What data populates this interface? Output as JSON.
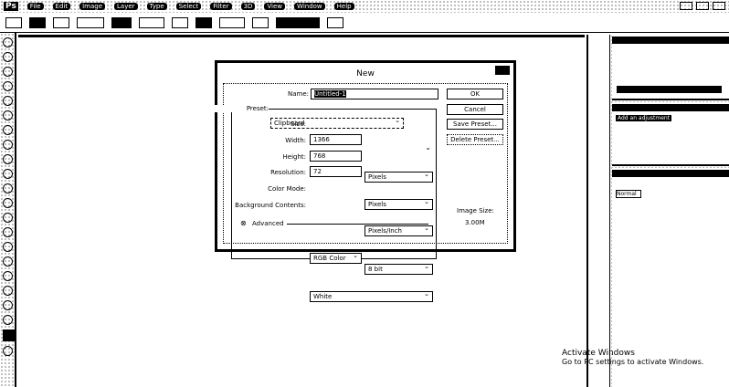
{
  "menubar": {
    "logo": "Ps",
    "items": [
      "File",
      "Edit",
      "Image",
      "Layer",
      "Type",
      "Select",
      "Filter",
      "3D",
      "View",
      "Window",
      "Help"
    ]
  },
  "dialog": {
    "title": "New",
    "name_label": "Name:",
    "name_value": "Untitled-1",
    "preset_label": "Preset:",
    "preset_value": "Clipboard",
    "size_label": "Size:",
    "size_value": "",
    "width_label": "Width:",
    "width_value": "1366",
    "width_unit": "Pixels",
    "height_label": "Height:",
    "height_value": "768",
    "height_unit": "Pixels",
    "resolution_label": "Resolution:",
    "resolution_value": "72",
    "resolution_unit": "Pixels/Inch",
    "color_mode_label": "Color Mode:",
    "color_mode_value": "RGB Color",
    "bit_depth": "8 bit",
    "background_label": "Background Contents:",
    "background_value": "White",
    "advanced_label": "Advanced",
    "ok": "OK",
    "cancel": "Cancel",
    "save_preset": "Save Preset...",
    "delete_preset": "Delete Preset...",
    "image_size_label": "Image Size:",
    "image_size_value": "3.00M"
  },
  "panel": {
    "adjustments_hint": "Add an adjustment",
    "blend_mode": "Normal"
  },
  "watermark": {
    "line1": "Activate Windows",
    "line2": "Go to PC settings to activate Windows."
  }
}
